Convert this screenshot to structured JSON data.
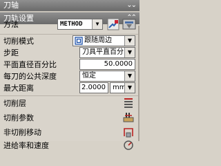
{
  "headers": {
    "top_title": "刀轴",
    "section_title": "刀轨设置"
  },
  "rows": {
    "method": {
      "label": "方法",
      "value": "METHOD"
    },
    "cut_pattern": {
      "label": "切削模式",
      "value": "跟随周边"
    },
    "stepover": {
      "label": "步距",
      "value": "刀具平直百分比"
    },
    "flat_dia_pct": {
      "label": "平面直径百分比",
      "value": "50.0000"
    },
    "depth_per_cut": {
      "label": "每刀的公共深度",
      "value": "恒定"
    },
    "max_distance": {
      "label": "最大距离",
      "value": "2.0000",
      "unit": "mm"
    },
    "cut_levels": {
      "label": "切削层"
    },
    "cut_params": {
      "label": "切削参数"
    },
    "non_cut_moves": {
      "label": "非切削移动"
    },
    "feeds_speeds": {
      "label": "进给率和速度"
    }
  },
  "icons": {
    "collapse": "double-chevron-up",
    "expand": "double-chevron-down",
    "dropdown": "triangle-down"
  }
}
